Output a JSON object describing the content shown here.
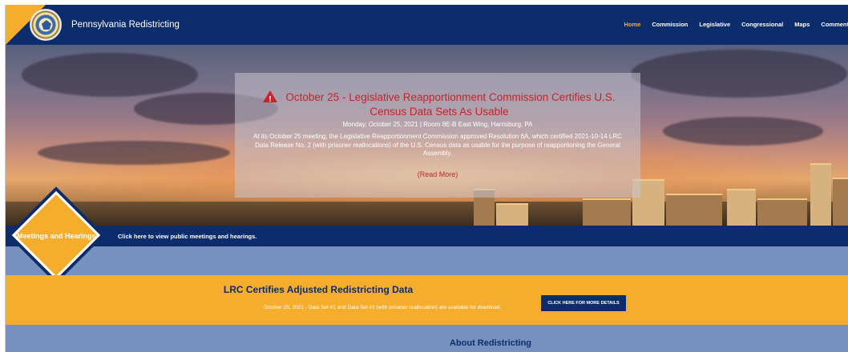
{
  "header": {
    "site_title": "Pennsylvania Redistricting",
    "nav": [
      {
        "label": "Home",
        "active": true
      },
      {
        "label": "Commission",
        "active": false
      },
      {
        "label": "Legislative",
        "active": false
      },
      {
        "label": "Congressional",
        "active": false
      },
      {
        "label": "Maps",
        "active": false
      },
      {
        "label": "Comment",
        "active": false
      }
    ]
  },
  "announcement": {
    "icon": "warning-icon",
    "title": "October 25 - Legislative Reapportionment Commission Certifies U.S. Census Data Sets As Usable",
    "date_location": "Monday, October 25, 2021 | Room 8E-B East Wing, Harrisburg, PA",
    "body": "At its October 25 meeting, the Legislative Reapportionment Commission approved Resolution 6A, which certified 2021-10-14 LRC Data Release No. 2 (with prisoner reallocations) of the U.S. Census data as usable for the purpose of reapportioning the General Assembly.",
    "read_more": "(Read More)"
  },
  "meetings": {
    "badge": "Meetings and Hearings",
    "link_text": "Click here to view public meetings and hearings."
  },
  "lrc": {
    "title": "LRC Certifies Adjusted Redistricting Data",
    "description": "October 25, 2021 - Data Set #1 and Data Set #2 (with prisoner reallocation) are available for download.",
    "button": "CLICK HERE FOR MORE DETAILS"
  },
  "about": {
    "title": "About Redistricting"
  },
  "colors": {
    "navy": "#0d2c6c",
    "gold": "#f5ad2e",
    "alert_red": "#c7232b",
    "band_blue": "#7690c0"
  }
}
